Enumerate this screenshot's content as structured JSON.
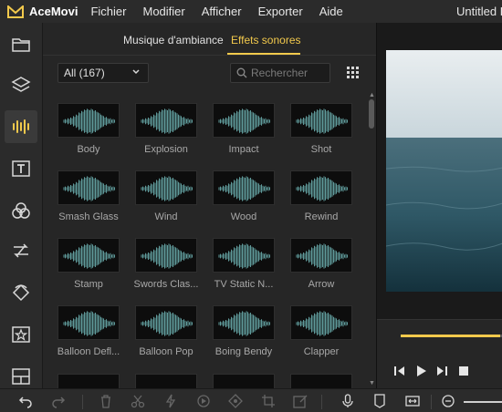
{
  "menubar": {
    "app_name": "AceMovi",
    "items": [
      "Fichier",
      "Modifier",
      "Afficher",
      "Exporter",
      "Aide"
    ],
    "window_title": "Untitled P"
  },
  "rail": {
    "items": [
      {
        "icon": "folder-icon",
        "active": false
      },
      {
        "icon": "layers-icon",
        "active": false
      },
      {
        "icon": "audio-icon",
        "active": true
      },
      {
        "icon": "text-icon",
        "active": false
      },
      {
        "icon": "filters-icon",
        "active": false
      },
      {
        "icon": "transitions-icon",
        "active": false
      },
      {
        "icon": "animation-icon",
        "active": false
      },
      {
        "icon": "sticker-icon",
        "active": false
      },
      {
        "icon": "split-screen-icon",
        "active": false
      }
    ]
  },
  "library": {
    "tabs": [
      "Musique d'ambiance",
      "Effets sonores"
    ],
    "active_tab": "Effets sonores",
    "filter_value": "All (167)",
    "search_placeholder": "Rechercher",
    "items": [
      "Body",
      "Explosion",
      "Impact",
      "Shot",
      "Smash Glass",
      "Wind",
      "Wood",
      "Rewind",
      "Stamp",
      "Swords Clas...",
      "TV Static N...",
      "Arrow",
      "Balloon Defl...",
      "Balloon Pop",
      "Boing Bendy",
      "Clapper"
    ]
  },
  "preview": {
    "progress": 0.97
  },
  "colors": {
    "accent": "#f2c94c",
    "waveform": "#5f9a9a",
    "background": "#1f1f1f",
    "panel": "#262626"
  }
}
